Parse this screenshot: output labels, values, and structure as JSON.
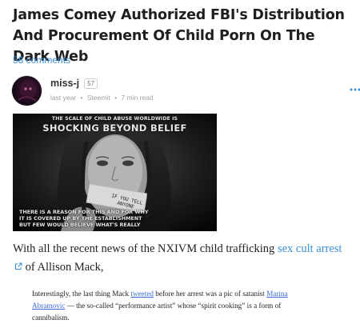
{
  "post": {
    "title": "James Comey Authorized FBI's Distribution And Procurement Of Child Porn On The Dark Web",
    "comments_label": "58 comments"
  },
  "author": {
    "name": "miss-j",
    "reputation": "57",
    "time": "last year",
    "separator": "•",
    "community": "Steemit",
    "read_time": "7 min read",
    "more_icon": "more-dots-icon"
  },
  "hero_image": {
    "caption_top_small": "THE SCALE OF CHILD ABUSE WORLDWIDE IS",
    "caption_top_big": "SHOCKING BEYOND BELIEF",
    "tape_line1": "IF  YOU  TELL",
    "tape_line2": "ANYONE",
    "caption_bottom_1": "THERE IS A REASON FOR THIS AND FOR WHY",
    "caption_bottom_2": "IT IS COVERED UP BY THE ESTABLISHMENT",
    "caption_bottom_3": "BUT FEW WOULD BELIEVE WHAT'S REALLY"
  },
  "body": {
    "para_prefix": "With all the recent news of the NXIVM child trafficking ",
    "para_link": "sex cult arrest",
    "para_suffix": " of Allison Mack,",
    "link_icon": "external-link-icon",
    "link_color": "#3b8fd6"
  },
  "quote": {
    "prefix": "Interestingly, the last thing Mack ",
    "link1": "tweeted",
    "middle": " before her arrest was a pic of satanist ",
    "link2": "Marina Abramovic",
    "suffix": " — the so-called “performance artist” whose “spirit cooking” is a form of cannibalism."
  }
}
